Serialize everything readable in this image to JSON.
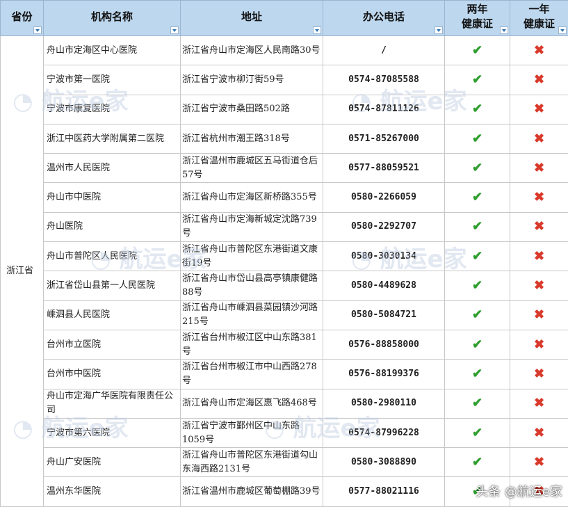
{
  "headers": {
    "province": "省份",
    "name": "机构名称",
    "address": "地址",
    "phone": "办公电话",
    "two_year": "两年\n健康证",
    "one_year": "一年\n健康证"
  },
  "province": "浙江省",
  "rows": [
    {
      "name": "舟山市定海区中心医院",
      "address": "浙江省舟山市定海区人民南路30号",
      "phone": "/",
      "two_year": "✔",
      "one_year": "✖"
    },
    {
      "name": "宁波市第一医院",
      "address": "浙江省宁波市柳汀街59号",
      "phone": "0574-87085588",
      "two_year": "✔",
      "one_year": "✖"
    },
    {
      "name": "宁波市康复医院",
      "address": "浙江省宁波市桑田路502路",
      "phone": "0574-87811126",
      "two_year": "✔",
      "one_year": "✖"
    },
    {
      "name": "浙江中医药大学附属第二医院",
      "address": "浙江省杭州市潮王路318号",
      "phone": "0571-85267000",
      "two_year": "✔",
      "one_year": "✖"
    },
    {
      "name": "温州市人民医院",
      "address": "浙江省温州市鹿城区五马街道仓后57号",
      "phone": "0577-88059521",
      "two_year": "✔",
      "one_year": "✖"
    },
    {
      "name": "舟山市中医院",
      "address": "浙江省舟山市定海区新桥路355号",
      "phone": "0580-2266059",
      "two_year": "✔",
      "one_year": "✖"
    },
    {
      "name": "舟山医院",
      "address": "浙江省舟山市定海新城定沈路739号",
      "phone": "0580-2292707",
      "two_year": "✔",
      "one_year": "✖"
    },
    {
      "name": "舟山市普陀区人民医院",
      "address": "浙江省舟山市普陀区东港街道文康街19号",
      "phone": "0580-3030134",
      "two_year": "✔",
      "one_year": "✖"
    },
    {
      "name": "浙江省岱山县第一人民医院",
      "address": "浙江省舟山市岱山县高亭镇康健路88号",
      "phone": "0580-4489628",
      "two_year": "✔",
      "one_year": "✖"
    },
    {
      "name": "嵊泗县人民医院",
      "address": "浙江省舟山市嵊泗县菜园镇沙河路215号",
      "phone": "0580-5084721",
      "two_year": "✔",
      "one_year": "✖"
    },
    {
      "name": "台州市立医院",
      "address": "浙江省台州市椒江区中山东路381号",
      "phone": "0576-88858000",
      "two_year": "✔",
      "one_year": "✖"
    },
    {
      "name": "台州市中医院",
      "address": "浙江省台州市椒江市中山西路278号",
      "phone": "0576-88199376",
      "two_year": "✔",
      "one_year": "✖"
    },
    {
      "name": "舟山市定海广华医院有限责任公司",
      "address": "浙江省舟山市定海区惠飞路468号",
      "phone": "0580-2980110",
      "two_year": "✔",
      "one_year": "✖"
    },
    {
      "name": "宁波市第六医院",
      "address": "浙江省宁波市鄞州区中山东路1059号",
      "phone": "0574-87996228",
      "two_year": "✔",
      "one_year": "✖"
    },
    {
      "name": "舟山广安医院",
      "address": "浙江省舟山市普陀区东港街道勾山东海西路2131号",
      "phone": "0580-3088890",
      "two_year": "✔",
      "one_year": "✖"
    },
    {
      "name": "温州东华医院",
      "address": "浙江省温州市鹿城区葡萄棚路39号",
      "phone": "0577-88021116",
      "two_year": "✔",
      "one_year": "✖"
    }
  ],
  "credit": "头条 @航运e家",
  "colors": {
    "header_bg": "#bdd7ee",
    "check": "#2f9e2f",
    "cross": "#d93a2b"
  }
}
